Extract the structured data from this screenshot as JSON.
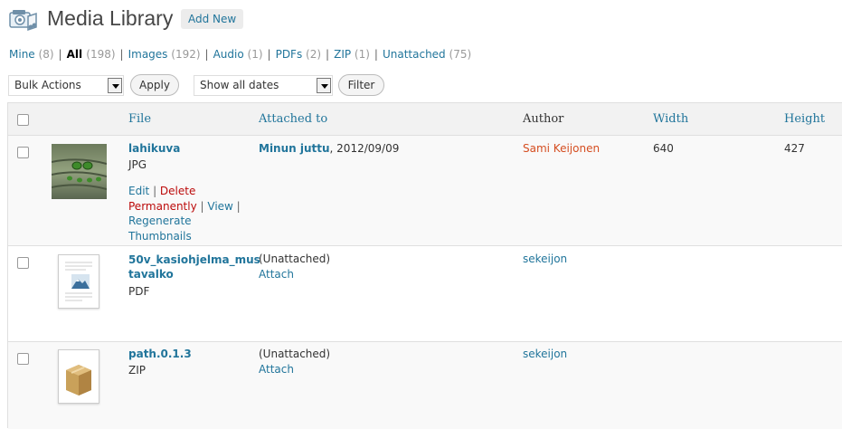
{
  "header": {
    "title": "Media Library",
    "add_new": "Add New"
  },
  "filters": [
    {
      "label": "Mine",
      "count": "(8)",
      "current": false
    },
    {
      "label": "All",
      "count": "(198)",
      "current": true
    },
    {
      "label": "Images",
      "count": "(192)",
      "current": false
    },
    {
      "label": "Audio",
      "count": "(1)",
      "current": false
    },
    {
      "label": "PDFs",
      "count": "(2)",
      "current": false
    },
    {
      "label": "ZIP",
      "count": "(1)",
      "current": false
    },
    {
      "label": "Unattached",
      "count": "(75)",
      "current": false
    }
  ],
  "separator": "|",
  "tablenav": {
    "bulk_actions": "Bulk Actions",
    "apply": "Apply",
    "dates": "Show all dates",
    "filter": "Filter"
  },
  "columns": {
    "file": "File",
    "attached_to": "Attached to",
    "author": "Author",
    "width": "Width",
    "height": "Height"
  },
  "rows": [
    {
      "title": "lahikuva",
      "type": "JPG",
      "actions": {
        "edit": "Edit",
        "delete": "Delete Permanently",
        "view": "View",
        "regenerate": "Regenerate Thumbnails"
      },
      "attached_parent": "Minun juttu",
      "attached_date": ", 2012/09/09",
      "author": "Sami Keijonen",
      "width": "640",
      "height": "427"
    },
    {
      "title": "50v_kasiohjelma_mus tavalko",
      "type": "PDF",
      "unattached": "(Unattached)",
      "attach": "Attach",
      "author": "sekeijon"
    },
    {
      "title": "path.0.1.3",
      "type": "ZIP",
      "unattached": "(Unattached)",
      "attach": "Attach",
      "author": "sekeijon"
    }
  ],
  "colors": {
    "link": "#21759b",
    "delete": "#bc0b0b",
    "highlight_author": "#d54e21"
  }
}
